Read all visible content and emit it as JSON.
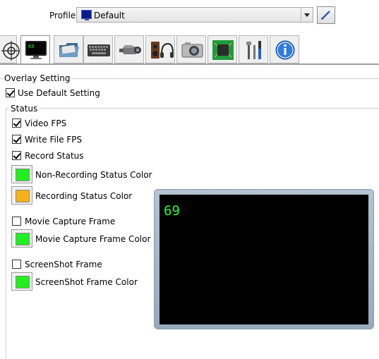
{
  "profile": {
    "label": "Profile",
    "selected_value": "Default",
    "edit_icon": "pencil-icon"
  },
  "tabs": [
    {
      "icon": "crosshair-icon",
      "active": false
    },
    {
      "icon": "monitor-fps-icon",
      "active": true
    },
    {
      "icon": "folder-icon",
      "active": false
    },
    {
      "icon": "keyboard-icon",
      "active": false
    },
    {
      "icon": "camcorder-icon",
      "active": false
    },
    {
      "icon": "speaker-headphones-icon",
      "active": false
    },
    {
      "icon": "camera-icon",
      "active": false
    },
    {
      "icon": "chip-icon",
      "active": false
    },
    {
      "icon": "tools-icon",
      "active": false
    },
    {
      "icon": "info-icon",
      "active": false
    }
  ],
  "overlay": {
    "title": "Overlay Setting",
    "use_default_label": "Use Default Setting",
    "use_default_checked": true
  },
  "status": {
    "title": "Status",
    "video_fps_label": "Video FPS",
    "video_fps_checked": true,
    "write_file_fps_label": "Write File FPS",
    "write_file_fps_checked": true,
    "record_status_label": "Record Status",
    "record_status_checked": true,
    "non_recording_color_label": "Non-Recording Status Color",
    "non_recording_color": "#22ee22",
    "recording_color_label": "Recording Status Color",
    "recording_color": "#f5b21a",
    "movie_capture_frame_label": "Movie Capture Frame",
    "movie_capture_frame_checked": false,
    "movie_capture_frame_color_label": "Movie Capture Frame Color",
    "movie_capture_frame_color": "#22ee22",
    "screenshot_frame_label": "ScreenShot Frame",
    "screenshot_frame_checked": false,
    "screenshot_frame_color_label": "ScreenShot Frame Color",
    "screenshot_frame_color": "#22ee22"
  },
  "preview": {
    "fps_value": "69"
  }
}
